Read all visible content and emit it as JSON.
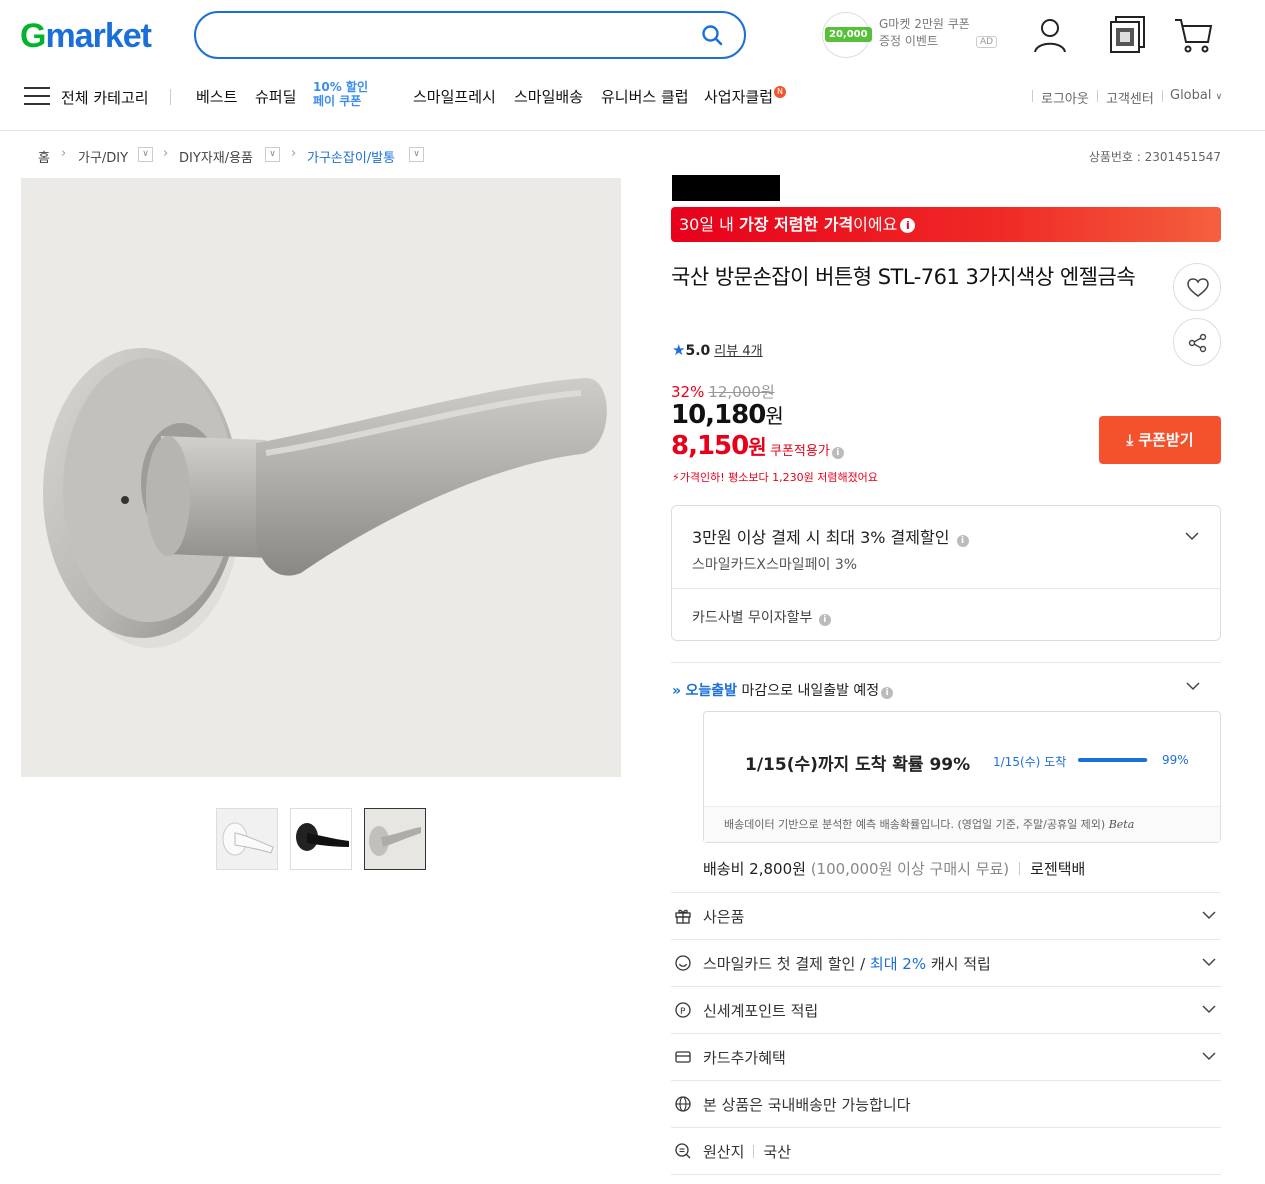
{
  "header": {
    "logo_g": "G",
    "logo_rest": "market",
    "search_placeholder": "",
    "ad": {
      "chip": "20,000",
      "text": "G마켓 2만원 쿠폰 증정 이벤트",
      "badge": "AD"
    }
  },
  "nav": {
    "all_categories": "전체 카테고리",
    "items": [
      "베스트",
      "슈퍼딜",
      "스마일프레시",
      "스마일배송",
      "유니버스 클럽",
      "사업자클럽"
    ],
    "promo_lines": [
      "10% 할인",
      "페이 쿠폰"
    ],
    "new_badge": "N",
    "util": [
      "로그아웃",
      "고객센터",
      "Global"
    ]
  },
  "breadcrumb": {
    "items": [
      "홈",
      "가구/DIY",
      "DIY자재/용품",
      "가구손잡이/발통"
    ],
    "product_no": "상품번호 : 2301451547"
  },
  "product": {
    "low_price_banner": {
      "pre": "30일 내 ",
      "bold": "가장 저렴한 가격",
      "post": "이에요"
    },
    "title": "국산 방문손잡이 버튼형 STL-761 3가지색상 엔젤금속",
    "rating": "5.0",
    "review_label": "리뷰 4개",
    "discount": "32%",
    "original_price": "12,000원",
    "price_num": "10,180",
    "price_unit": "원",
    "coupon_price_num": "8,150",
    "coupon_price_unit": "원",
    "coupon_price_label": "쿠폰적용가",
    "price_drop_note": "가격인하! 평소보다 1,230원 저렴해졌어요",
    "coupon_button": "쿠폰받기",
    "thumbs_count": 3
  },
  "payment": {
    "headline": "3만원 이상 결제 시 최대 3% 결제할인",
    "sub": "스마일카드X스마일페이 3%",
    "installment": "카드사별 무이자할부"
  },
  "shipping": {
    "badge": "오늘출발",
    "text": "마감으로 내일출발 예정",
    "prob_main": "1/15(수)까지 도착 확률 99%",
    "prob_small": "1/15(수) 도착",
    "prob_value": 0.99,
    "prob_pct": "99%",
    "prob_note": "배송데이터 기반으로 분석한 예측 배송확률입니다. (영업일 기준, 주말/공휴일 제외)",
    "beta": "Beta",
    "fee": "배송비 2,800원",
    "fee_cond": "(100,000원 이상 구매시 무료)",
    "carrier": "로젠택배"
  },
  "benefits": {
    "gift": "사은품",
    "smilecard_pre": "스마일카드 첫 결제 할인 / ",
    "smilecard_blue": "최대 2%",
    "smilecard_post": " 캐시 적립",
    "ssg_point": "신세계포인트 적립",
    "card_extra": "카드추가혜택",
    "domestic": "본 상품은 국내배송만 가능합니다",
    "origin_label": "원산지",
    "origin_value": "국산"
  },
  "colors": {
    "accent": "#1b6fd8",
    "sale": "#e8001b",
    "coupon_btn": "#f4522c",
    "logo_green": "#00b52d"
  }
}
